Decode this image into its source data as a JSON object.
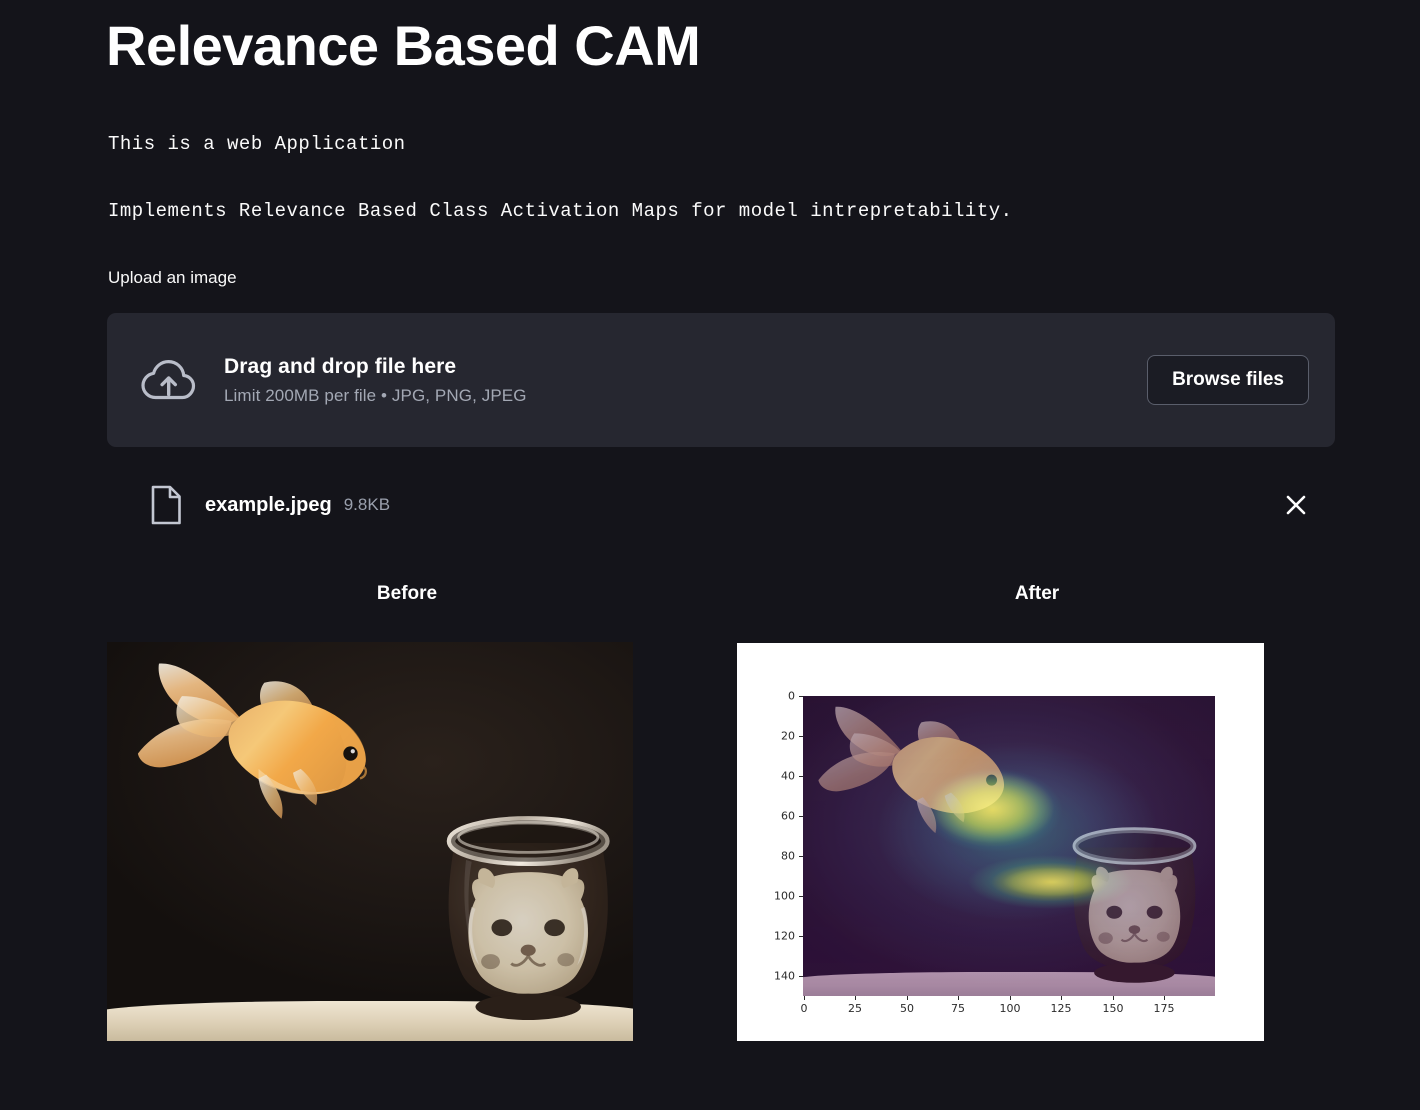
{
  "app": {
    "title": "Relevance Based CAM",
    "intro_line_1": "This is a web Application",
    "intro_line_2": "Implements Relevance Based Class Activation Maps for model intrepretability.",
    "background_color": "#14141a"
  },
  "uploader": {
    "label": "Upload an image",
    "drag_text": "Drag and drop file here",
    "limit_text": "Limit 200MB per file • JPG, PNG, JPEG",
    "browse_button": "Browse files",
    "cloud_icon": "cloud-upload-icon",
    "panel_color": "#262730"
  },
  "uploaded_file": {
    "file_icon": "file-document-icon",
    "name": "example.jpeg",
    "size": "9.8KB",
    "close_icon": "close-icon"
  },
  "columns": {
    "before_caption": "Before",
    "after_caption": "After"
  },
  "chart_data": {
    "type": "heatmap",
    "title": "",
    "xlabel": "",
    "ylabel": "",
    "colormap": "viridis",
    "xlim": [
      0,
      199
    ],
    "ylim": [
      149,
      0
    ],
    "xticks": [
      0,
      25,
      50,
      75,
      100,
      125,
      150,
      175
    ],
    "yticks": [
      0,
      20,
      40,
      60,
      80,
      100,
      120,
      140
    ],
    "xtick_labels": [
      "0",
      "25",
      "50",
      "75",
      "100",
      "125",
      "150",
      "175"
    ],
    "ytick_labels": [
      "0",
      "20",
      "40",
      "60",
      "80",
      "100",
      "120",
      "140"
    ],
    "grid": false,
    "legend": "none",
    "figure_facecolor": "#ffffff",
    "description": "Relevance based class activation map overlaid on the goldfish photograph; highest relevance (yellow) concentrated on the goldfish body and head near x 55-115, y 30-80, fading through green and teal to dark purple at the image borders.",
    "hotspots": [
      {
        "x": 72,
        "y": 42,
        "value": 1.0,
        "color": "#fde725"
      },
      {
        "x": 100,
        "y": 48,
        "value": 0.92,
        "color": "#d8e219"
      },
      {
        "x": 118,
        "y": 72,
        "value": 0.85,
        "color": "#b5de2b"
      },
      {
        "x": 50,
        "y": 38,
        "value": 0.7,
        "color": "#6ece58"
      },
      {
        "x": 135,
        "y": 65,
        "value": 0.5,
        "color": "#35b779"
      },
      {
        "x": 160,
        "y": 55,
        "value": 0.34,
        "color": "#21918c"
      },
      {
        "x": 30,
        "y": 100,
        "value": 0.15,
        "color": "#3b528b"
      },
      {
        "x": 185,
        "y": 130,
        "value": 0.05,
        "color": "#440154"
      }
    ],
    "image_content": "Goldfish floating above a glass bowl containing a white cat's face"
  },
  "before_image": {
    "alt": "Goldfish suspended above a glass fishbowl containing a white cat face on a dark background"
  }
}
